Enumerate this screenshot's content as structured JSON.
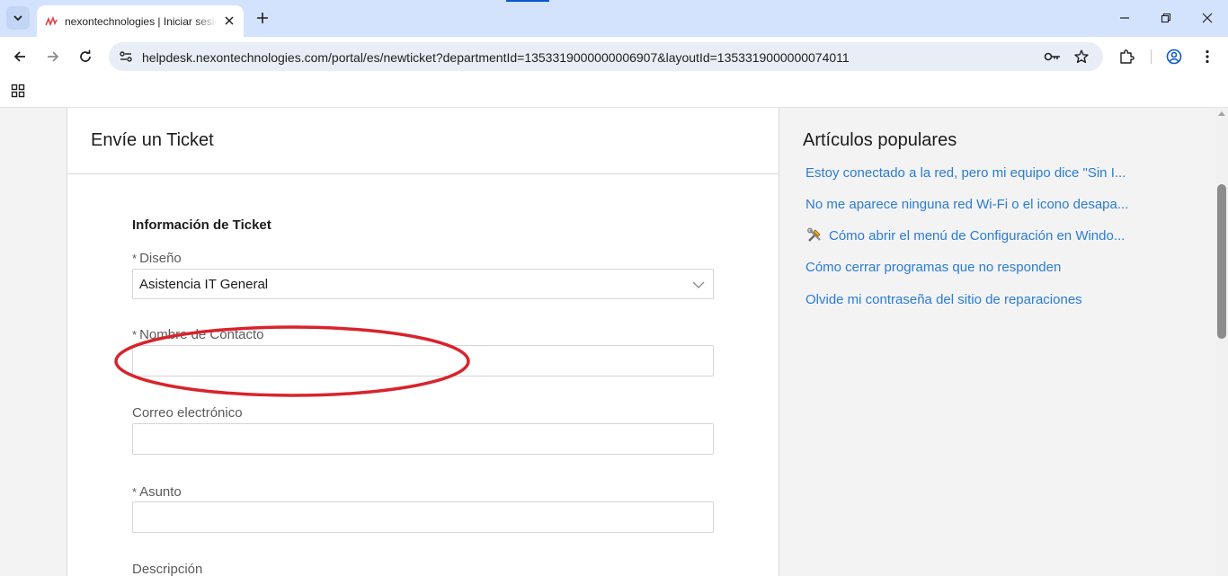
{
  "browser": {
    "tab": {
      "title": "nexontechnologies | Iniciar sesión"
    },
    "url": "helpdesk.nexontechnologies.com/portal/es/newticket?departmentId=1353319000000006907&layoutId=1353319000000074011"
  },
  "form": {
    "page_title": "Envíe un Ticket",
    "section_title": "Información de Ticket",
    "required_marker": "*",
    "layout": {
      "label": "Diseño",
      "value": "Asistencia IT General"
    },
    "contact_name": {
      "label": "Nombre de Contacto",
      "value": ""
    },
    "email": {
      "label": "Correo electrónico",
      "value": ""
    },
    "subject": {
      "label": "Asunto",
      "value": ""
    },
    "description": {
      "label": "Descripción"
    }
  },
  "sidebar": {
    "title": "Artículos populares",
    "articles": [
      {
        "label": "Estoy conectado a la red, pero mi equipo dice \"Sin I..."
      },
      {
        "label": "No me aparece ninguna red Wi-Fi o el icono desapa..."
      },
      {
        "label": "Cómo abrir el menú de Configuración en Windo...",
        "icon": "tools-icon"
      },
      {
        "label": "Cómo cerrar programas que no responden"
      },
      {
        "label": "Olvide mi contraseña del sitio de reparaciones"
      }
    ]
  },
  "annotation": {
    "shape": "ellipse",
    "color": "#d9232b"
  },
  "colors": {
    "link": "#2b7cd3",
    "tabstrip": "#d3e3fd",
    "omnibox": "#e9eef6"
  }
}
